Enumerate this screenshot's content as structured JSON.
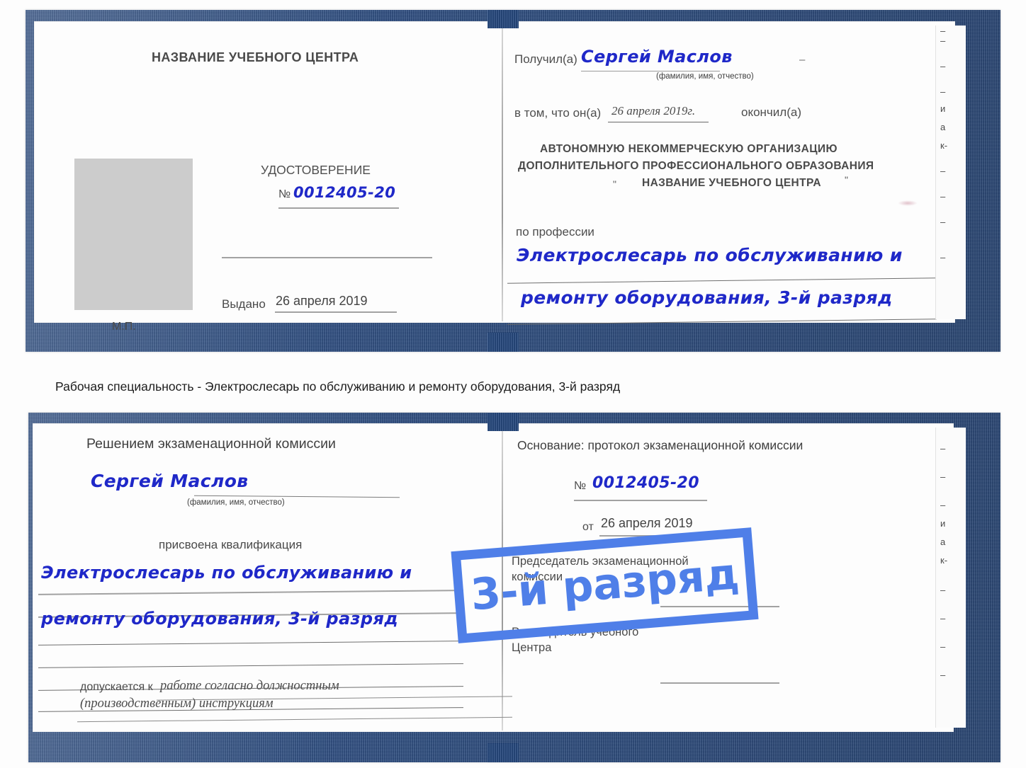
{
  "document": {
    "kind": "certificate-scan",
    "colors": {
      "cover": "#27497f",
      "handwriting": "#1f28c8",
      "stamp": "#4f7fe8",
      "photo_placeholder": "#cccccc",
      "paper": "#fdfdfd"
    }
  },
  "caption": "Рабочая специальность - Электрослесарь по обслуживанию и ремонту оборудования, 3-й разряд",
  "watermark": {
    "label": "3-й разряд"
  },
  "certificate_front": {
    "left_page": {
      "center_name": "НАЗВАНИЕ УЧЕБНОГО ЦЕНТРА",
      "title": "УДОСТОВЕРЕНИЕ",
      "number_sign": "№",
      "number_value": "0012405-20",
      "issued_label": "Выдано",
      "issued_value": "26 апреля 2019",
      "seal_label": "М.П."
    },
    "right_page": {
      "received_label": "Получил(а)",
      "received_value": "Сергей Маслов",
      "received_hint": "(фамилия, имя, отчество)",
      "that_label": "в том, что он(а)",
      "that_date": "26 апреля 2019г.",
      "finished_label": "окончил(а)",
      "org_line1": "АВТОНОМНУЮ НЕКОММЕРЧЕСКУЮ ОРГАНИЗАЦИЮ",
      "org_line2": "ДОПОЛНИТЕЛЬНОГО ПРОФЕССИОНАЛЬНОГО ОБРАЗОВАНИЯ",
      "org_quote_open": "\"",
      "org_line3": "НАЗВАНИЕ УЧЕБНОГО ЦЕНТРА",
      "org_quote_close": "\"",
      "profession_label": "по профессии",
      "profession_line1": "Электрослесарь по обслуживанию и",
      "profession_line2": "ремонту оборудования, 3-й разряд"
    }
  },
  "certificate_back": {
    "left_page": {
      "heading": "Решением экзаменационной комиссии",
      "name_value": "Сергей Маслов",
      "name_hint": "(фамилия, имя, отчество)",
      "qualification_label": "присвоена квалификация",
      "qualification_line1": "Электрослесарь по обслуживанию и",
      "qualification_line2": "ремонту оборудования, 3-й разряд",
      "allowed_label": "допускается к",
      "allowed_value_line1": "работе согласно должностным",
      "allowed_value_line2": "(производственным) инструкциям"
    },
    "right_page": {
      "basis_label": "Основание: протокол экзаменационной комиссии",
      "number_sign": "№",
      "number_value": "0012405-20",
      "date_label": "от",
      "date_value": "26 апреля 2019",
      "chairman_line1": "Председатель экзаменационной",
      "chairman_line2": "комиссии",
      "head_line1": "Руководитель учебного",
      "head_line2": "Центра"
    }
  },
  "page_edge_fragments_top": [
    "–",
    "–",
    "–",
    "и",
    "а",
    "к-",
    "–",
    "–",
    "–",
    "–"
  ],
  "page_edge_fragments_bottom": [
    "–",
    "–",
    "–",
    "и",
    "а",
    "к-",
    "–",
    "–",
    "–",
    "–"
  ]
}
